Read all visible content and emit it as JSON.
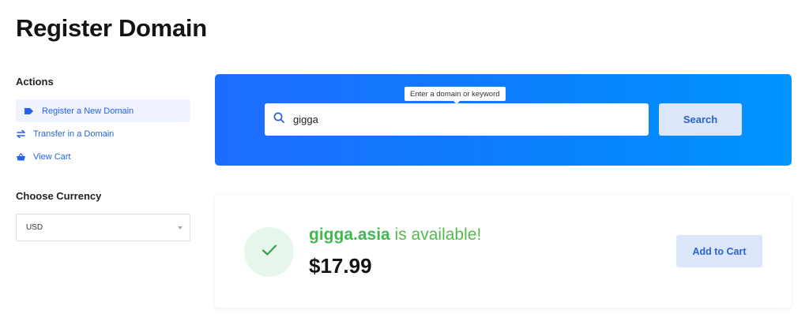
{
  "page": {
    "title": "Register Domain"
  },
  "sidebar": {
    "actions_heading": "Actions",
    "items": [
      {
        "label": "Register a New Domain",
        "icon": "tag-icon",
        "active": true
      },
      {
        "label": "Transfer in a Domain",
        "icon": "transfer-arrows-icon",
        "active": false
      },
      {
        "label": "View Cart",
        "icon": "basket-icon",
        "active": false
      }
    ],
    "currency_heading": "Choose Currency",
    "currency_value": "USD"
  },
  "search": {
    "tooltip": "Enter a domain or keyword",
    "value": "gigga",
    "button_label": "Search",
    "icon": "search-icon"
  },
  "result": {
    "domain": "gigga.asia",
    "status_text": "is available!",
    "price": "$17.99",
    "cart_button_label": "Add to Cart",
    "icon": "check-icon"
  },
  "colors": {
    "accent": "#2563eb",
    "panel_gradient_start": "#1e6cff",
    "panel_gradient_end": "#0095ff",
    "success": "#3fb950",
    "button_bg": "#dbe6fb"
  }
}
